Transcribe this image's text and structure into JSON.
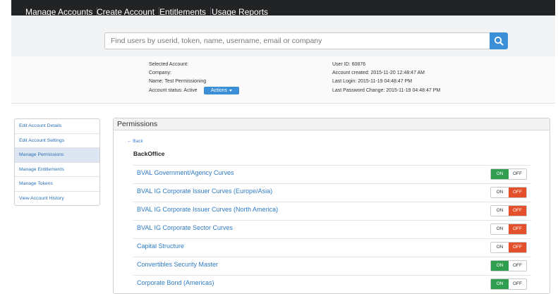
{
  "nav": {
    "items": [
      "Manage Accounts",
      "Create Account",
      "Entitlements",
      "Usage Reports"
    ]
  },
  "search": {
    "placeholder": "Find users by userid, token, name, username, email or company",
    "icon": "search-icon"
  },
  "account": {
    "selected_label": "Selected Account:",
    "company_label": "Company:",
    "name_label": "Name: Test Permissioning",
    "status_label": "Account status: Active",
    "actions_label": "Actions",
    "user_id": "User ID: 60876",
    "created": "Account created: 2015-11-20 12:48:47 AM",
    "last_login": "Last Login: 2015-11-19 04:48:47 PM",
    "last_password_change": "Last Password Change: 2015-11-19 04:48:47 PM"
  },
  "sidebar": {
    "items": [
      {
        "label": "Edit Account Details",
        "active": false
      },
      {
        "label": "Edit Account Settings",
        "active": false
      },
      {
        "label": "Manage Permissions",
        "active": true
      },
      {
        "label": "Manage Entitlements",
        "active": false
      },
      {
        "label": "Manage Tokens",
        "active": false
      },
      {
        "label": "View Account History",
        "active": false
      }
    ]
  },
  "permissions": {
    "title": "Permissions",
    "back": "← Back",
    "section": "BackOffice",
    "on_label": "ON",
    "off_label": "OFF",
    "rows": [
      {
        "name": "BVAL Government/Agency Curves",
        "state": "on"
      },
      {
        "name": "BVAL IG Corporate Issuer Curves (Europe/Asia)",
        "state": "off"
      },
      {
        "name": "BVAL IG Corporate Issuer Curves (North America)",
        "state": "off"
      },
      {
        "name": "BVAL IG Corporate Sector Curves",
        "state": "off"
      },
      {
        "name": "Capital Structure",
        "state": "off"
      },
      {
        "name": "Convertibles Security Master",
        "state": "on"
      },
      {
        "name": "Corporate Bond (Americas)",
        "state": "on"
      }
    ]
  },
  "colors": {
    "on": "#2f9e4f",
    "off": "#e3502b",
    "accent": "#3a8fd6",
    "navbar": "#222325"
  }
}
